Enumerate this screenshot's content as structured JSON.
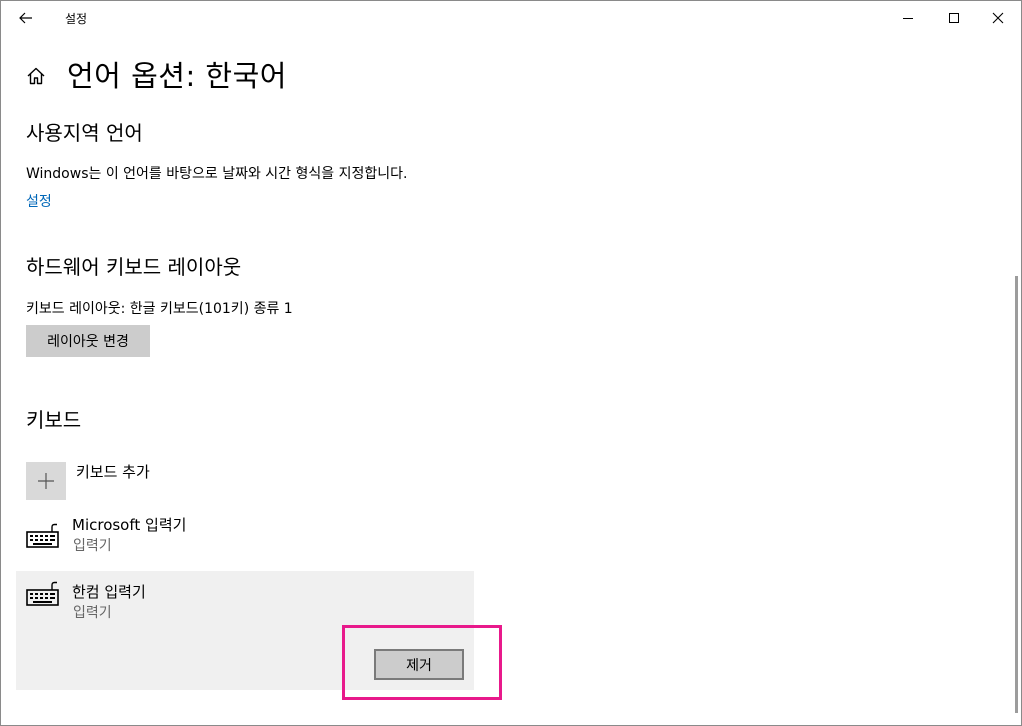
{
  "window": {
    "title": "설정",
    "back_icon": "back-arrow-icon",
    "minimize_icon": "minimize-icon",
    "maximize_icon": "maximize-icon",
    "close_icon": "close-icon"
  },
  "header": {
    "home_icon": "home-icon",
    "title": "언어 옵션: 한국어"
  },
  "regional": {
    "heading": "사용지역 언어",
    "description": "Windows는 이 언어를 바탕으로 날짜와 시간 형식을 지정합니다.",
    "link": "설정"
  },
  "hardware_keyboard": {
    "heading": "하드웨어 키보드 레이아웃",
    "current_layout": "키보드 레이아웃: 한글 키보드(101키) 종류 1",
    "change_button": "레이아웃 변경"
  },
  "keyboards": {
    "heading": "키보드",
    "add_label": "키보드 추가",
    "add_icon": "plus-icon",
    "items": [
      {
        "name": "Microsoft 입력기",
        "type": "입력기",
        "icon": "keyboard-icon"
      },
      {
        "name": "한컴 입력기",
        "type": "입력기",
        "icon": "keyboard-icon",
        "selected": true
      }
    ],
    "remove_button": "제거"
  },
  "colors": {
    "link": "#0067b8",
    "highlight": "#e8198b",
    "button_bg": "#cccccc",
    "selected_bg": "#f0f0f0"
  }
}
